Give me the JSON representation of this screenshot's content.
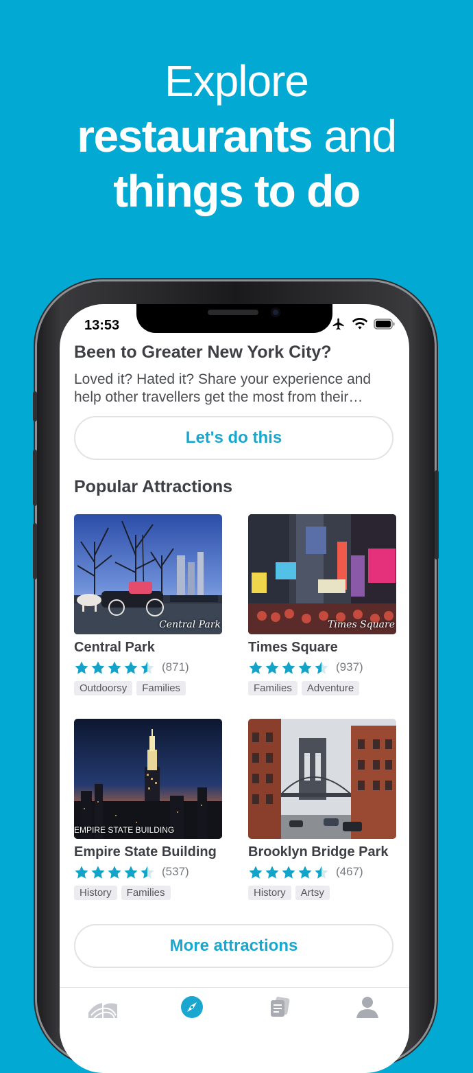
{
  "headline": {
    "line1": "Explore",
    "line2_bold": "restaurants",
    "line2_light": " and",
    "line3": "things to do"
  },
  "status_bar": {
    "time": "13:53",
    "icons": [
      "airplane-icon",
      "wifi-icon",
      "battery-icon"
    ]
  },
  "prompt": {
    "title": "Been to Greater New York City?",
    "body_line1": "Loved it? Hated it? Share your experience and",
    "body_line2": "help other travellers get the most from their…",
    "button": "Let's do this"
  },
  "attractions": {
    "title": "Popular Attractions",
    "items": [
      {
        "name": "Central Park",
        "rating": 4.5,
        "reviews": "(871)",
        "tags": [
          "Outdoorsy",
          "Families"
        ],
        "photo_caption": "Central Park"
      },
      {
        "name": "Times Square",
        "rating": 4.5,
        "reviews": "(937)",
        "tags": [
          "Families",
          "Adventure"
        ],
        "photo_caption": "Times Square"
      },
      {
        "name": "Empire State Building",
        "rating": 4.5,
        "reviews": "(537)",
        "tags": [
          "History",
          "Families"
        ],
        "photo_caption": "EMPIRE STATE BUILDING"
      },
      {
        "name": "Brooklyn Bridge Park",
        "rating": 4.5,
        "reviews": "(467)",
        "tags": [
          "History",
          "Artsy"
        ],
        "photo_caption": ""
      }
    ],
    "more_button": "More attractions"
  },
  "tabbar": {
    "items": [
      "skyline-icon",
      "compass-icon",
      "cards-icon",
      "profile-icon"
    ],
    "active": "compass-icon"
  },
  "colors": {
    "background": "#02aad3",
    "accent": "#19a7cf",
    "star": "#13a3c9"
  }
}
